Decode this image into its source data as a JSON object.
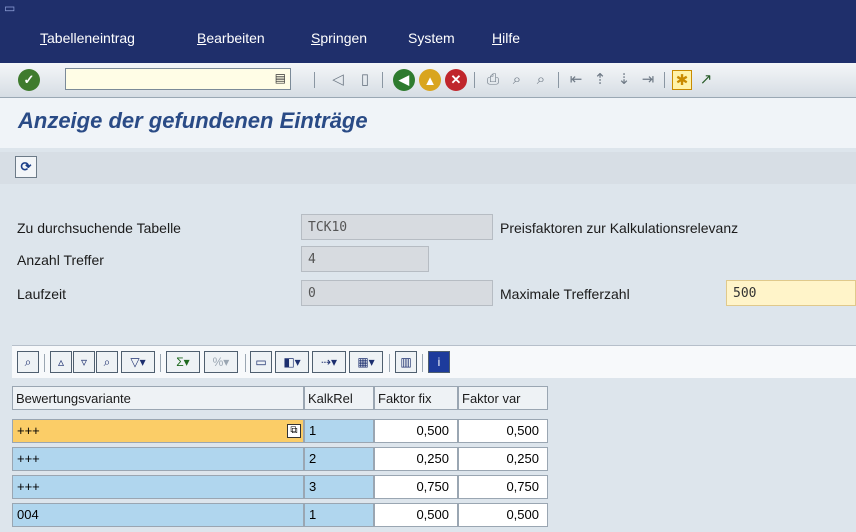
{
  "menu": {
    "items": [
      "Tabelleneintrag",
      "Bearbeiten",
      "Springen",
      "System",
      "Hilfe"
    ],
    "underline": [
      "T",
      "B",
      "S",
      "",
      "H"
    ]
  },
  "toolbar": {
    "command_value": "",
    "icons": [
      "ok-check-icon",
      "dropdown-icon",
      "back-arrow-icon",
      "save-icon",
      "back-icon",
      "exit-icon",
      "cancel-icon",
      "print-icon",
      "find-icon",
      "find-next-icon",
      "first-page-icon",
      "previous-page-icon",
      "next-page-icon",
      "last-page-icon",
      "new-session-icon",
      "shortcut-icon"
    ]
  },
  "page": {
    "title": "Anzeige der gefundenen Einträge"
  },
  "form": {
    "table_label": "Zu durchsuchende Tabelle",
    "table_value": "TCK10",
    "table_desc": "Preisfaktoren zur Kalkulationsrelevanz",
    "hits_label": "Anzahl Treffer",
    "hits_value": "4",
    "runtime_label": "Laufzeit",
    "runtime_value": "0",
    "max_hits_label": "Maximale Trefferzahl",
    "max_hits_value": "500"
  },
  "grid": {
    "columns": [
      "Bewertungsvariante",
      "KalkRel",
      "Faktor fix",
      "Faktor var"
    ],
    "rows": [
      [
        "+++",
        "1",
        "0,500",
        "0,500"
      ],
      [
        "+++",
        "2",
        "0,250",
        "0,250"
      ],
      [
        "+++",
        "3",
        "0,750",
        "0,750"
      ],
      [
        "004",
        "1",
        "0,500",
        "0,500"
      ]
    ]
  },
  "colors": {
    "menubar": "#1f2f6b",
    "title": "#2a4b86",
    "selected_row": "#fbcd67",
    "key_cell": "#b0d6ee"
  }
}
